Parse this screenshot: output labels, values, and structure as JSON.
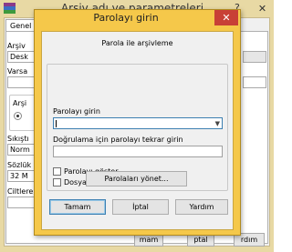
{
  "background_window": {
    "title": "Arşiv adı ve parametreleri",
    "help_glyph": "?",
    "close_glyph": "✕",
    "tab_general": "Genel",
    "archive_label_partial": "Arşiv",
    "archive_field_partial": "Desk",
    "update_label_partial": "Varsa",
    "archive_format_label_partial": "Arşi",
    "compression_label_partial": "Sıkıştı",
    "compression_value_partial": "Norm",
    "dictionary_label_partial": "Sözlük",
    "dictionary_value_partial": "32 M",
    "split_label_partial": "Ciltlere",
    "ok_partial": "mam",
    "cancel_partial": "ptal",
    "help_partial": "rdım"
  },
  "dialog": {
    "title": "Parolayı girin",
    "close_glyph": "✕",
    "subtitle": "Parola ile arşivleme",
    "password_label": "Parolayı girin",
    "password_value": "",
    "confirm_label": "Doğrulama için parolayı tekrar girin",
    "confirm_value": "",
    "show_password_label": "Parolayı göster",
    "show_password_checked": false,
    "encrypt_names_label": "Dosya isimlerini gifrele",
    "encrypt_names_checked": false,
    "manage_passwords_button": "Parolaları yönet...",
    "ok_button": "Tamam",
    "cancel_button": "İptal",
    "help_button": "Yardım"
  },
  "colors": {
    "dialog_frame": "#f5c84a",
    "background_frame": "#e8d9a4",
    "close_button": "#c84036",
    "focus_border": "#3c7fb1"
  },
  "icons": {
    "app_icon": "winrar-books-icon",
    "dropdown_arrow": "chevron-down-icon",
    "close": "close-icon"
  }
}
